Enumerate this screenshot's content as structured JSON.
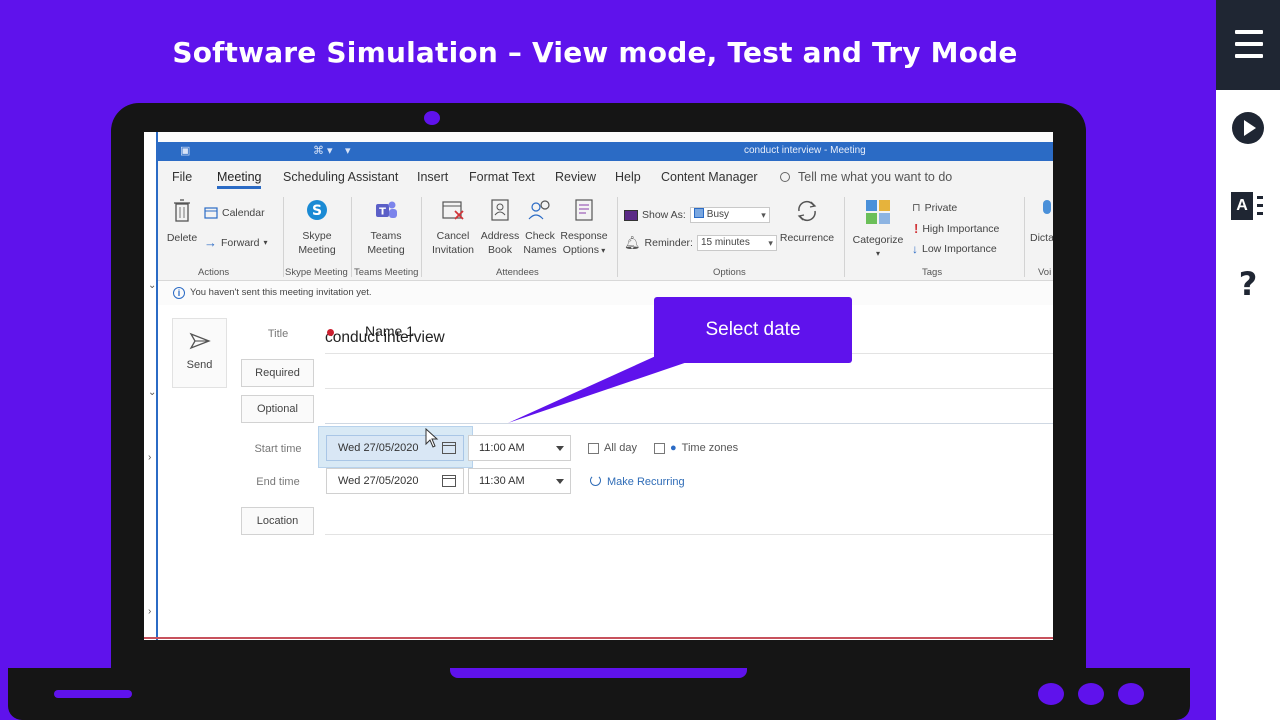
{
  "banner": {
    "title": "Software Simulation – View mode, Test and Try Mode"
  },
  "outlook": {
    "window_title": "conduct interview  -  Meeting",
    "tabs": [
      "File",
      "Meeting",
      "Scheduling Assistant",
      "Insert",
      "Format Text",
      "Review",
      "Help",
      "Content Manager"
    ],
    "active_tab": "Meeting",
    "tell_me": "Tell me what you want to do",
    "ribbon": {
      "actions": {
        "delete": "Delete",
        "calendar": "Calendar",
        "forward": "Forward",
        "group": "Actions"
      },
      "skype": {
        "line1": "Skype",
        "line2": "Meeting",
        "group": "Skype Meeting"
      },
      "teams": {
        "line1": "Teams",
        "line2": "Meeting",
        "group": "Teams Meeting"
      },
      "attendees": {
        "cancel1": "Cancel",
        "cancel2": "Invitation",
        "address1": "Address",
        "address2": "Book",
        "check1": "Check",
        "check2": "Names",
        "response1": "Response",
        "response2": "Options",
        "group": "Attendees"
      },
      "options": {
        "show_as_label": "Show As:",
        "show_as_value": "Busy",
        "reminder_label": "Reminder:",
        "reminder_value": "15 minutes",
        "recurrence": "Recurrence",
        "group": "Options"
      },
      "tags": {
        "categorize": "Categorize",
        "private": "Private",
        "high": "High Importance",
        "low": "Low Importance",
        "group": "Tags"
      },
      "voice": {
        "dictate": "Dicta",
        "group": "Voi"
      }
    },
    "info_message": "You haven't sent this meeting invitation yet.",
    "form": {
      "send": "Send",
      "title_label": "Title",
      "title_value": "conduct interview",
      "required_label": "Required",
      "required_value": "Name 1",
      "optional_label": "Optional",
      "start_label": "Start time",
      "start_date": "Wed 27/05/2020",
      "start_time": "11:00 AM",
      "all_day": "All day",
      "time_zones": "Time zones",
      "end_label": "End time",
      "end_date": "Wed 27/05/2020",
      "end_time": "11:30 AM",
      "make_recurring": "Make Recurring",
      "location_label": "Location"
    }
  },
  "callout": {
    "text": "Select date"
  },
  "colors": {
    "background": "#5f12ec",
    "accent": "#2b6bc5",
    "rail_dark": "#1f2633"
  },
  "rail": {
    "icons": [
      "menu-icon",
      "play-icon",
      "glossary-icon",
      "help-icon"
    ],
    "glossary_letter": "A",
    "help_glyph": "?"
  }
}
